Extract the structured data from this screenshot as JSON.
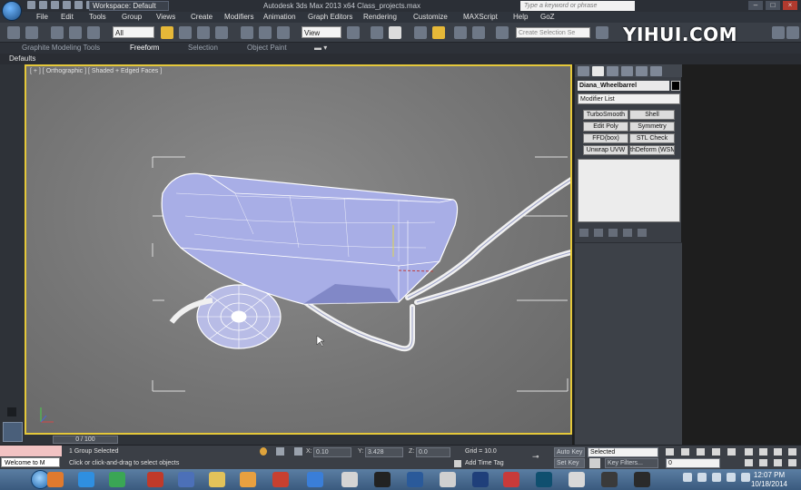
{
  "titlebar": {
    "workspace": "Workspace: Default",
    "title": "Autodesk 3ds Max 2013 x64    Class_projects.max",
    "search_placeholder": "Type a keyword or phrase"
  },
  "menu": [
    "File",
    "Edit",
    "Tools",
    "Group",
    "Views",
    "Create",
    "Modifiers",
    "Animation",
    "Graph Editors",
    "Rendering",
    "Customize",
    "MAXScript",
    "Help",
    "GoZ"
  ],
  "toolbar": {
    "filter": "All",
    "view": "View",
    "selection_set_placeholder": "Create Selection Se"
  },
  "watermark": "YIHUI.COM",
  "ribbon": {
    "tabs": [
      "Graphite Modeling Tools",
      "Freeform",
      "Selection",
      "Object Paint"
    ],
    "active_tab": "Freeform",
    "sub_label": "Defaults"
  },
  "viewport": {
    "label": "[ + ] [ Orthographic ] [ Shaded + Edged Faces ]",
    "colors": {
      "border": "#e5c83a",
      "mesh_fill": "#a8aee6",
      "mesh_wire": "#ffffff",
      "gizmo": "#e0d64a"
    }
  },
  "command_panel": {
    "object_name": "Diana_Wheelbarrel",
    "modifier_list": "Modifier List",
    "modifier_buttons": [
      "TurboSmooth",
      "Shell",
      "Edit Poly",
      "Symmetry",
      "FFD(box)",
      "STL Check",
      "Unwrap UVW",
      "thDeform (WSM)"
    ]
  },
  "timeline": {
    "frame": "0 / 100"
  },
  "status": {
    "selection": "1 Group Selected",
    "prompt": "Click or click-and-drag to select objects",
    "x_label": "X:",
    "x_value": "0.10",
    "y_label": "Y:",
    "y_value": "3.428",
    "z_label": "Z:",
    "z_value": "0.0",
    "grid": "Grid = 10.0",
    "add_time_tag": "Add Time Tag",
    "auto_key": "Auto Key",
    "auto_key_value": "Selected",
    "set_key": "Set Key",
    "key_filters": "Key Filters...",
    "frame_field": "0",
    "welcome": "Welcome to M"
  },
  "taskbar": {
    "time": "12:07 PM",
    "date": "10/18/2014"
  }
}
